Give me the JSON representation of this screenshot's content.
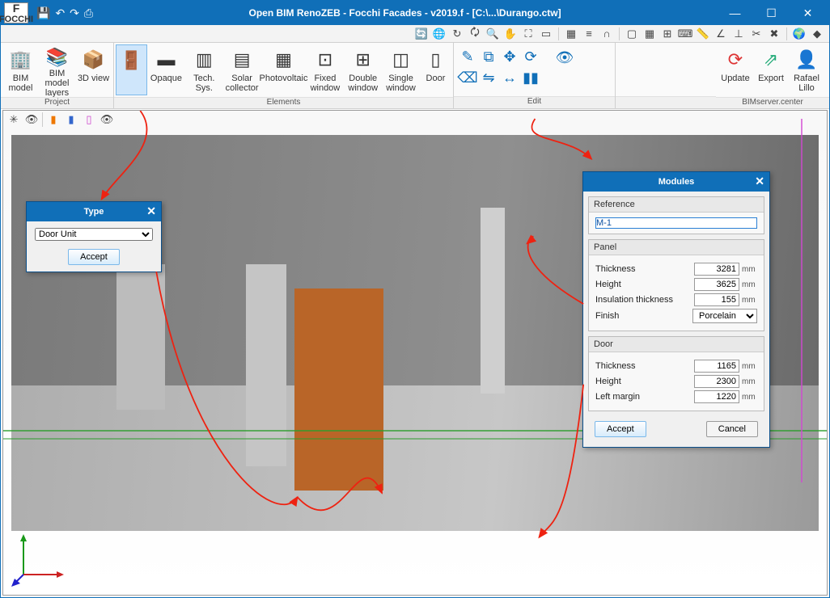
{
  "title": "Open BIM RenoZEB - Focchi Facades - v2019.f - [C:\\...\\Durango.ctw]",
  "logo": "FOCCHI",
  "ribbon": {
    "project": {
      "label": "Project",
      "items": [
        {
          "label": "BIM model"
        },
        {
          "label": "BIM model layers"
        },
        {
          "label": "3D view"
        }
      ]
    },
    "elements": {
      "label": "Elements",
      "items": [
        {
          "label": "Opaque"
        },
        {
          "label": "Tech. Sys."
        },
        {
          "label": "Solar collector"
        },
        {
          "label": "Photovoltaic"
        },
        {
          "label": "Fixed window"
        },
        {
          "label": "Double window"
        },
        {
          "label": "Single window"
        },
        {
          "label": "Door"
        }
      ]
    },
    "edit": {
      "label": "Edit"
    },
    "center": {
      "label": "BIMserver.center",
      "items": [
        {
          "label": "Update"
        },
        {
          "label": "Export"
        },
        {
          "label": "Rafael Lillo"
        }
      ]
    }
  },
  "type_dialog": {
    "title": "Type",
    "value": "Door Unit",
    "accept": "Accept"
  },
  "modules_dialog": {
    "title": "Modules",
    "reference": {
      "label": "Reference",
      "value": "M-1"
    },
    "panel": {
      "label": "Panel",
      "thickness": {
        "label": "Thickness",
        "value": "3281",
        "unit": "mm"
      },
      "height": {
        "label": "Height",
        "value": "3625",
        "unit": "mm"
      },
      "insulation": {
        "label": "Insulation thickness",
        "value": "155",
        "unit": "mm"
      },
      "finish": {
        "label": "Finish",
        "value": "Porcelain"
      }
    },
    "door": {
      "label": "Door",
      "thickness": {
        "label": "Thickness",
        "value": "1165",
        "unit": "mm"
      },
      "height": {
        "label": "Height",
        "value": "2300",
        "unit": "mm"
      },
      "left": {
        "label": "Left margin",
        "value": "1220",
        "unit": "mm"
      }
    },
    "accept": "Accept",
    "cancel": "Cancel"
  }
}
